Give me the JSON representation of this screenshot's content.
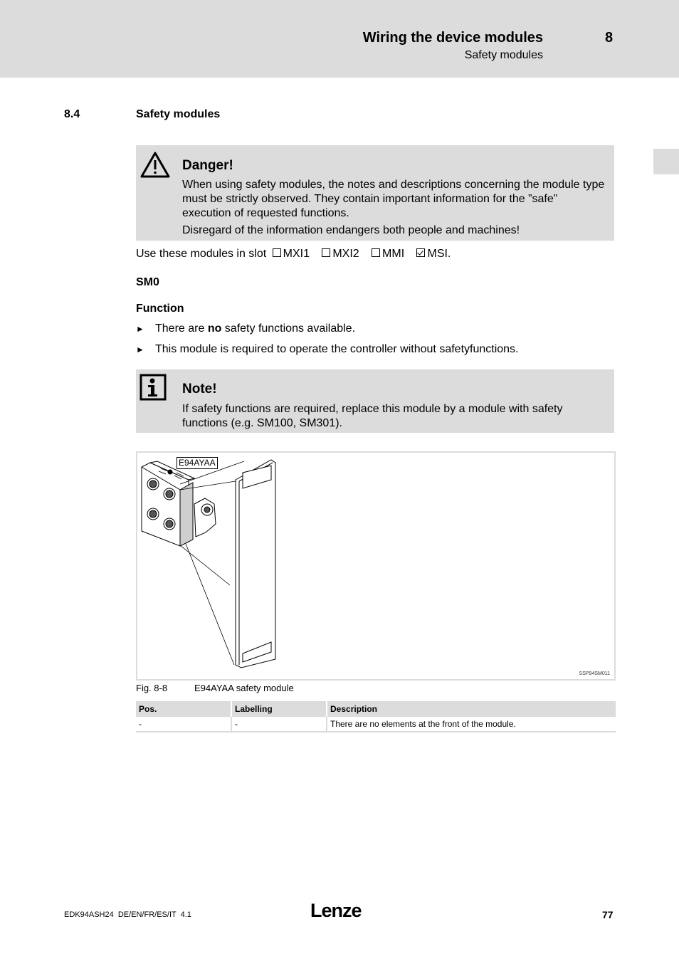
{
  "header": {
    "title": "Wiring the device modules",
    "chapter": "8",
    "subtitle": "Safety modules"
  },
  "section": {
    "number": "8.4",
    "title": "Safety modules"
  },
  "danger": {
    "icon": "warning-triangle-icon",
    "title": "Danger!",
    "paragraph1": "When using safety modules, the notes and descriptions concerning the module type must be strictly observed. They contain important information for the ”safe” execution of requested functions.",
    "paragraph2": "Disregard of the information endangers both people and machines!"
  },
  "slots": {
    "prefix": "Use these modules in slot",
    "items": [
      {
        "label": "MXI1",
        "checked": false
      },
      {
        "label": "MXI2",
        "checked": false
      },
      {
        "label": "MMI",
        "checked": false
      },
      {
        "label": "MSI.",
        "checked": true
      }
    ]
  },
  "module_heading": "SM0",
  "function": {
    "heading": "Function",
    "bullets": [
      {
        "before": "There are ",
        "bold": "no",
        "after": " safety functions available."
      },
      {
        "before": "This module is required to operate the controller without safetyfunctions.",
        "bold": "",
        "after": ""
      }
    ]
  },
  "note": {
    "icon": "info-icon",
    "title": "Note!",
    "paragraph1": "If safety functions are required, replace this module by a module with safety functions (e.g. SM100, SM301)."
  },
  "figure": {
    "label": "E94AYAA",
    "code": "SSP94SM011",
    "caption_number": "Fig. 8-8",
    "caption_text": "E94AYAA safety module"
  },
  "table": {
    "headers": [
      "Pos.",
      "Labelling",
      "Description"
    ],
    "rows": [
      [
        "-",
        "-",
        "There are no elements at the front of the module."
      ]
    ]
  },
  "footer": {
    "doc_id": "EDK94ASH24  DE/EN/FR/ES/IT  4.1",
    "logo": "Lenze",
    "page": "77"
  }
}
